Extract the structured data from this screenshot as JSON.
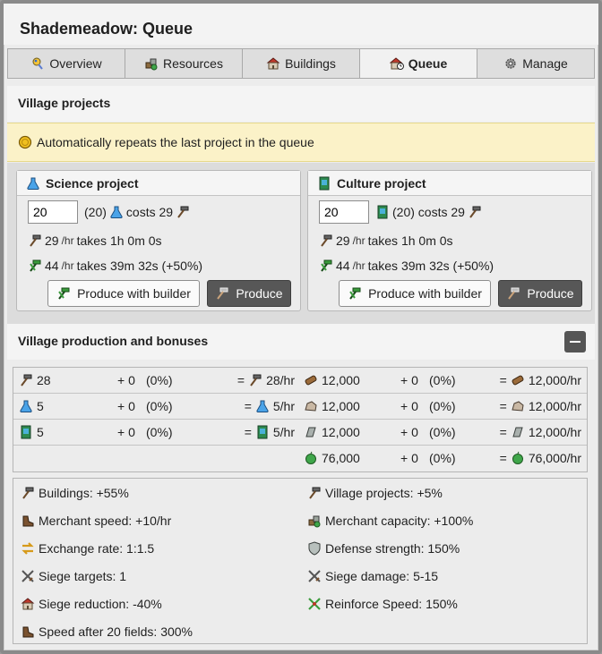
{
  "window": {
    "title": "Shademeadow: Queue"
  },
  "tabs": [
    {
      "label": "Overview",
      "icon": "globe-icon"
    },
    {
      "label": "Resources",
      "icon": "resources-icon"
    },
    {
      "label": "Buildings",
      "icon": "building-icon"
    },
    {
      "label": "Queue",
      "icon": "clock-house-icon",
      "active": true
    },
    {
      "label": "Manage",
      "icon": "gear-icon"
    }
  ],
  "projects": {
    "header": "Village projects",
    "notice": "Automatically repeats the last project in the queue",
    "science": {
      "title": "Science project",
      "quantity": "20",
      "count": "(20)",
      "costs_text": "costs 29",
      "rate1": "29",
      "unit": "/hr",
      "takes1": "takes 1h 0m 0s",
      "rate2": "44",
      "takes2": "takes 39m 32s (+50%)",
      "btn_builder": "Produce with builder",
      "btn_produce": "Produce"
    },
    "culture": {
      "title": "Culture project",
      "quantity": "20",
      "count": "(20) costs 29",
      "rate1": "29",
      "unit": "/hr",
      "takes1": "takes 1h 0m 0s",
      "rate2": "44",
      "takes2": "takes 39m 32s (+50%)",
      "btn_builder": "Produce with builder",
      "btn_produce": "Produce"
    }
  },
  "production": {
    "header": "Village production and bonuses",
    "rows": [
      {
        "left": {
          "icon": "hammer-icon",
          "base": "28",
          "plus": "+ 0",
          "pct": "(0%)",
          "eq": "=",
          "total": "28/hr"
        },
        "right": {
          "icon": "wood-icon",
          "base": "12,000",
          "plus": "+ 0",
          "pct": "(0%)",
          "eq": "=",
          "total": "12,000/hr"
        }
      },
      {
        "left": {
          "icon": "flask-icon",
          "base": "5",
          "plus": "+ 0",
          "pct": "(0%)",
          "eq": "=",
          "total": "5/hr"
        },
        "right": {
          "icon": "stone-icon",
          "base": "12,000",
          "plus": "+ 0",
          "pct": "(0%)",
          "eq": "=",
          "total": "12,000/hr"
        }
      },
      {
        "left": {
          "icon": "painting-icon",
          "base": "5",
          "plus": "+ 0",
          "pct": "(0%)",
          "eq": "=",
          "total": "5/hr"
        },
        "right": {
          "icon": "iron-icon",
          "base": "12,000",
          "plus": "+ 0",
          "pct": "(0%)",
          "eq": "=",
          "total": "12,000/hr"
        }
      },
      {
        "right": {
          "icon": "food-icon",
          "base": "76,000",
          "plus": "+ 0",
          "pct": "(0%)",
          "eq": "=",
          "total": "76,000/hr"
        }
      }
    ]
  },
  "bonuses": [
    {
      "icon": "hammer-icon",
      "text": "Buildings: +55%"
    },
    {
      "icon": "hammer-icon",
      "text": "Village projects: +5%"
    },
    {
      "icon": "boot-icon",
      "text": "Merchant speed: +10/hr"
    },
    {
      "icon": "resources-icon",
      "text": "Merchant capacity: +100%"
    },
    {
      "icon": "exchange-icon",
      "text": "Exchange rate: 1:1.5"
    },
    {
      "icon": "shield-icon",
      "text": "Defense strength: 150%"
    },
    {
      "icon": "swords-icon",
      "text": "Siege targets: 1"
    },
    {
      "icon": "swords-icon",
      "text": "Siege damage: 5-15"
    },
    {
      "icon": "building-icon",
      "text": "Siege reduction: -40%"
    },
    {
      "icon": "reinforce-icon",
      "text": "Reinforce Speed: 150%"
    },
    {
      "icon": "boot-icon",
      "text": "Speed after 20 fields: 300%"
    }
  ],
  "colors": {
    "accent_dark_button": "#575757",
    "notice_bg": "#fbf2c8",
    "hammer_green": "#3a9b3c"
  }
}
